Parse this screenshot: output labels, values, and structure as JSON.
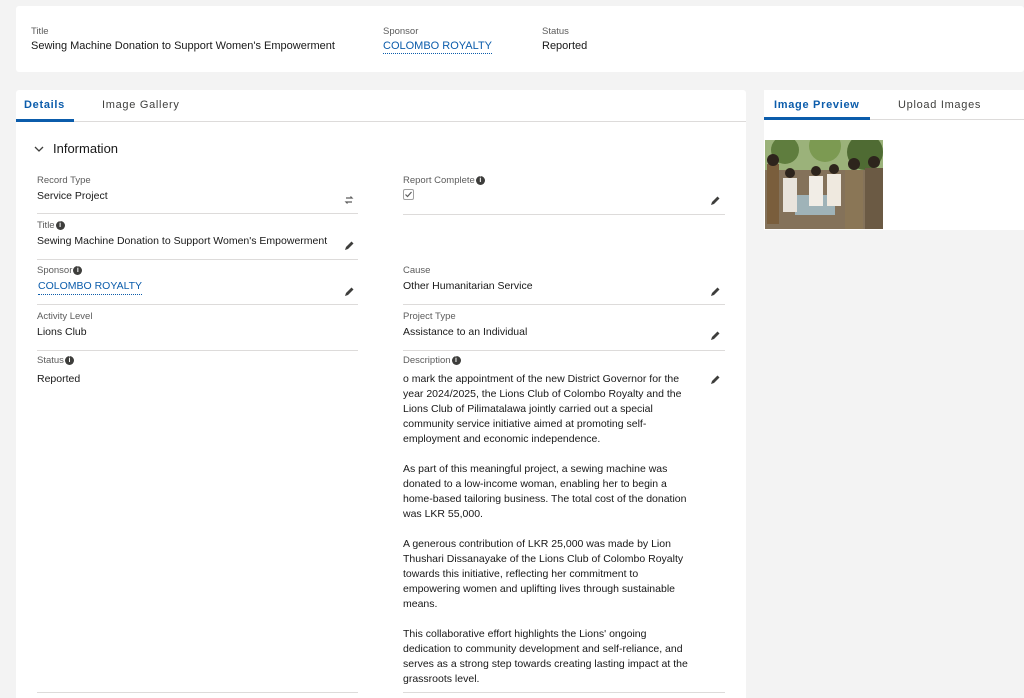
{
  "header": {
    "title_label": "Title",
    "title_value": "Sewing Machine Donation to Support Women's Empowerment",
    "sponsor_label": "Sponsor",
    "sponsor_value": "COLOMBO ROYALTY",
    "status_label": "Status",
    "status_value": "Reported"
  },
  "tabs": {
    "details": "Details",
    "gallery": "Image Gallery"
  },
  "section": {
    "title": "Information"
  },
  "fields": {
    "record_type": {
      "label": "Record Type",
      "value": "Service Project"
    },
    "report_complete": {
      "label": "Report Complete",
      "checked": true
    },
    "title": {
      "label": "Title",
      "value": "Sewing Machine Donation to Support Women's Empowerment"
    },
    "sponsor": {
      "label": "Sponsor",
      "value": "COLOMBO ROYALTY"
    },
    "cause": {
      "label": "Cause",
      "value": "Other Humanitarian Service"
    },
    "activity_level": {
      "label": "Activity Level",
      "value": "Lions Club"
    },
    "project_type": {
      "label": "Project Type",
      "value": "Assistance to an Individual"
    },
    "status": {
      "label": "Status",
      "value": "Reported"
    },
    "description": {
      "label": "Description",
      "p1": "o mark the appointment of the new District Governor for the year 2024/2025, the Lions Club of Colombo Royalty and the Lions Club of Pilimatalawa jointly carried out a special community service initiative aimed at promoting self-employment and economic independence.",
      "p2": "As part of this meaningful project, a sewing machine was donated to a low-income woman, enabling her to begin a home-based tailoring business. The total cost of the donation was LKR 55,000.",
      "p3": "A generous contribution of LKR 25,000 was made by Lion Thushari Dissanayake of the Lions Club of Colombo Royalty towards this initiative, reflecting her commitment to empowering women and uplifting lives through sustainable means.",
      "p4": "This collaborative effort highlights the Lions' ongoing dedication to community development and self-reliance, and serves as a strong step towards creating lasting impact at the grassroots level."
    }
  },
  "right_tabs": {
    "preview": "Image Preview",
    "upload": "Upload Images"
  },
  "colors": {
    "accent": "#0b5cab",
    "background": "#f3f3f3"
  }
}
